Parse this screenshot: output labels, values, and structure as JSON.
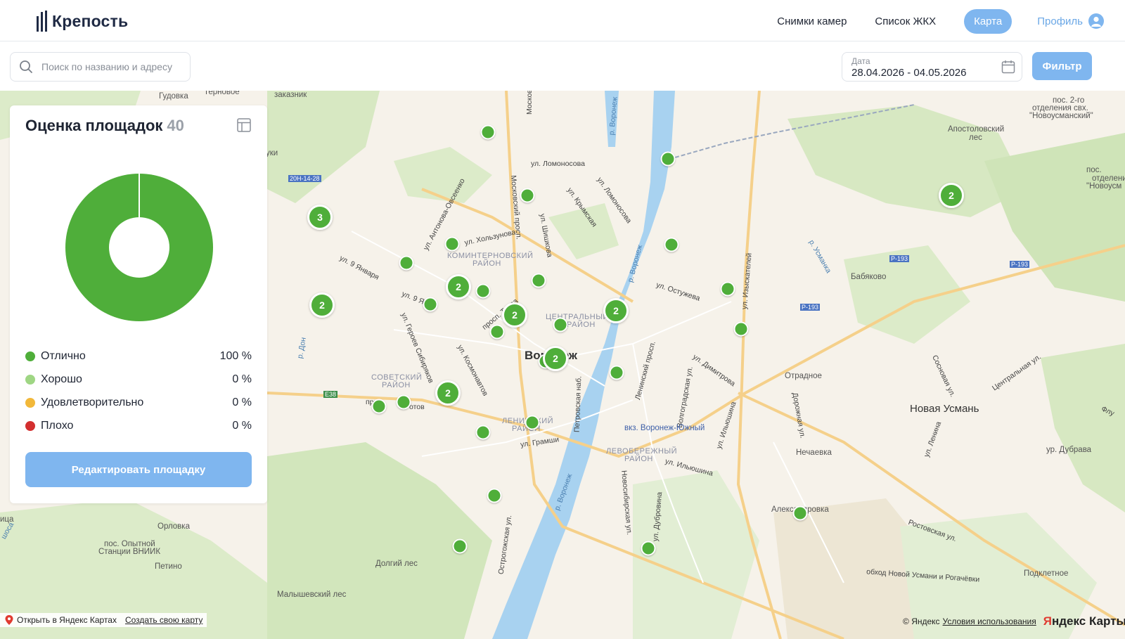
{
  "header": {
    "logo_text": "Крепость",
    "nav": {
      "camera_shots": "Снимки камер",
      "housing_list": "Список ЖКХ",
      "map": "Карта",
      "profile": "Профиль"
    }
  },
  "toolbar": {
    "search_placeholder": "Поиск по названию и адресу",
    "date_label": "Дата",
    "date_value": "28.04.2026 - 04.05.2026",
    "filter_label": "Фильтр"
  },
  "panel": {
    "title": "Оценка площадок",
    "count": "40",
    "legend": [
      {
        "label": "Отлично",
        "value": "100 %",
        "color": "#4fae3a"
      },
      {
        "label": "Хорошо",
        "value": "0 %",
        "color": "#9fd684"
      },
      {
        "label": "Удовлетворительно",
        "value": "0 %",
        "color": "#f2b83a"
      },
      {
        "label": "Плохо",
        "value": "0 %",
        "color": "#d32f2f"
      }
    ],
    "edit_button": "Редактировать площадку",
    "donut_share_excellent": 1.0
  },
  "map": {
    "labels": {
      "gudovka": "Гудовка",
      "ternovoe": "Терновое",
      "zakaznik": "заказник",
      "moskov": "Москов",
      "voronezh_river_top": "р. Воронеж",
      "lomonosova": "ул. Ломоносова",
      "lomonosova2": "ул. Ломоносова",
      "pos2": "пос. 2-го",
      "pos2b": "отделения свх.",
      "pos2c": "\"Новоусманский\"",
      "apostolovsky": "Апостоловский",
      "apostolovsky2": "лес",
      "posotd": "пос.",
      "posotd2": "отделени",
      "posotd3": "\"Новоусм",
      "road_20n": "20Н-14-28",
      "antonova": "ул. Антонова-Овсеенко",
      "moskovsky": "Московский просп.",
      "krymskaya": "ул. Крымская",
      "hol": "ул. Хользунова",
      "shishkova": "ул. Шишкова",
      "komintern": "КОМИНТЕРНОВСКИЙ",
      "komintern2": "РАЙОН",
      "jan9": "ул. 9 Января",
      "jan9b": "ул. 9 Янва",
      "truda": "просп. Труда",
      "central": "ЦЕНТРАЛЬНЫЙ",
      "central2": "РАЙОН",
      "voronezh_city": "Воронеж",
      "ostuzheva": "ул. Остужева",
      "izyskateley": "ул. Изыскателей",
      "p193": "Р-193",
      "p193b": "Р-193",
      "p193c": "Р-193",
      "babyakovo": "Бабяково",
      "usmanka": "р. Усманка",
      "geroev": "ул. Героев Сибиряков",
      "kosmonavtov": "ул. Космонавтов",
      "sovetsky": "СОВЕТСКИЙ",
      "sovetsky2": "РАЙОН",
      "e38": "Е38",
      "leninsky_pr": "Ленинский просп.",
      "dimitrova": "ул. Димитрова",
      "otradnoe": "Отрадное",
      "novaya_usman": "Новая Усмань",
      "volgograd": "Волгоградская ул.",
      "leninsky": "ЛЕНИНСКИЙ",
      "leninsky2": "РАЙОН",
      "gramshi": "ул. Грамши",
      "petrovskaya": "Петровская наб.",
      "vokzal": "вкз. Воронеж-Южный",
      "levoberezh": "ЛЕВОБЕРЕЖНЫЙ",
      "levoberezh2": "РАЙОН",
      "ilyushina": "ул. Ильюшина",
      "ilyushina2": "ул. Ильюшина",
      "dorozhnaya": "Дорожная ул.",
      "lenina": "ул. Ленина",
      "nechaevka": "Нечаевка",
      "dubrava": "ур. Дубрава",
      "rostovskaya": "Ростовская ул.",
      "aleksandrovka": "Александровка",
      "sosnovaya": "Сосновая ул.",
      "centralnaya": "Центральная ул.",
      "orlovka": "Орловка",
      "opytny": "пос. Опытной",
      "opytny2": "Станции ВНИИК",
      "petino": "Петино",
      "dolgiy": "Долгий лес",
      "malyshevsky": "Малышевский лес",
      "ostrogozhskaya": "Острогожская ул.",
      "novosibirskaya": "Новосибирская ул.",
      "dubrovina": "ул. Дубровина",
      "voronezh_river_bottom": "р. Воронеж",
      "voronezh_river_mid": "р. Воронеж",
      "obhod": "обход Новой Усмани и Рогачёвки",
      "podkletnoe": "Подклетное",
      "don": "р. Дон",
      "pri": "при",
      "totov": "отов",
      "yki": "уки",
      "ica": "ица",
      "shosa": "шоса",
      "fly": "Флу"
    },
    "footer": {
      "open_in": "Открыть в Яндекс Картах",
      "create_map": "Создать свою карту",
      "copyright": "© Яндекс",
      "terms": "Условия использования",
      "logo_y": "Я",
      "logo_rest": "ндекс Карты"
    },
    "clusters": [
      "3",
      "2",
      "2",
      "2",
      "2",
      "2",
      "2"
    ]
  }
}
